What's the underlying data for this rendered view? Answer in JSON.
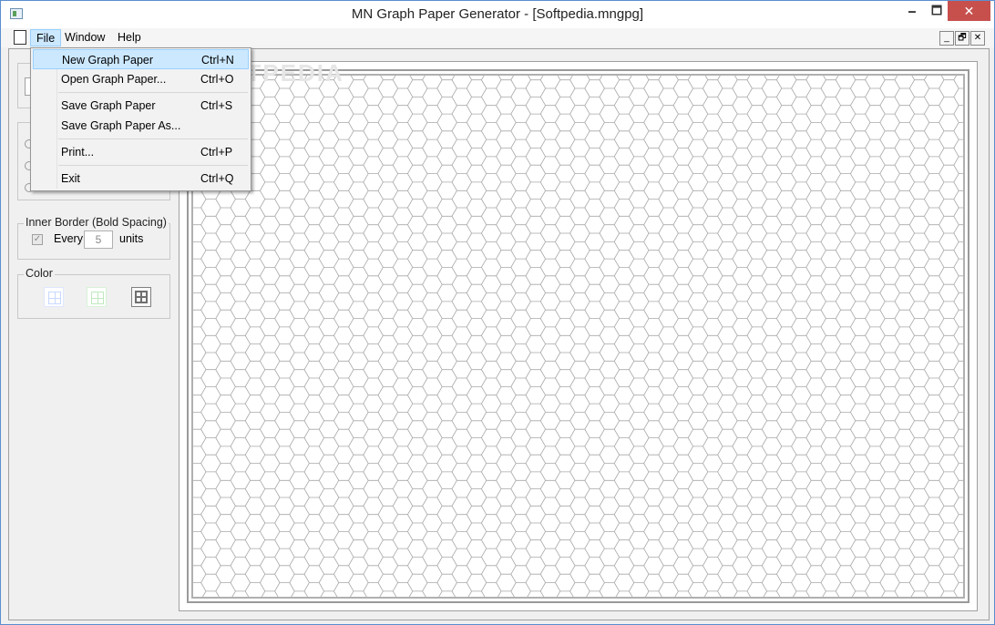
{
  "window": {
    "title": "MN Graph Paper Generator - [Softpedia.mngpg]",
    "minimize_glyph": "🗕",
    "maximize_glyph": "🗖",
    "close_glyph": "✕"
  },
  "menubar": {
    "items": [
      {
        "label": "File"
      },
      {
        "label": "Window"
      },
      {
        "label": "Help"
      }
    ],
    "mdi_controls": {
      "minimize": "_",
      "restore": "🗗",
      "close": "✕"
    }
  },
  "file_menu": {
    "items": [
      {
        "label": "New Graph Paper",
        "shortcut": "Ctrl+N",
        "highlighted": true
      },
      {
        "label": "Open Graph Paper...",
        "shortcut": "Ctrl+O"
      },
      {
        "label": "Save Graph Paper",
        "shortcut": "Ctrl+S"
      },
      {
        "label": "Save Graph Paper As...",
        "shortcut": ""
      },
      {
        "label": "Print...",
        "shortcut": "Ctrl+P"
      },
      {
        "label": "Exit",
        "shortcut": "Ctrl+Q"
      }
    ]
  },
  "left_panel": {
    "inner_border": {
      "title": "Inner Border (Bold Spacing)",
      "checked": true,
      "every_label": "Every",
      "value": "5",
      "units_label": "units"
    },
    "color": {
      "title": "Color",
      "swatches": [
        "#c8d8ff",
        "#bfe8bf",
        "#808080"
      ]
    }
  },
  "paper": {
    "pattern": "hexagon",
    "line_color": "#a8a8a8",
    "background": "#ffffff"
  },
  "watermark": "SOFTPEDIA"
}
